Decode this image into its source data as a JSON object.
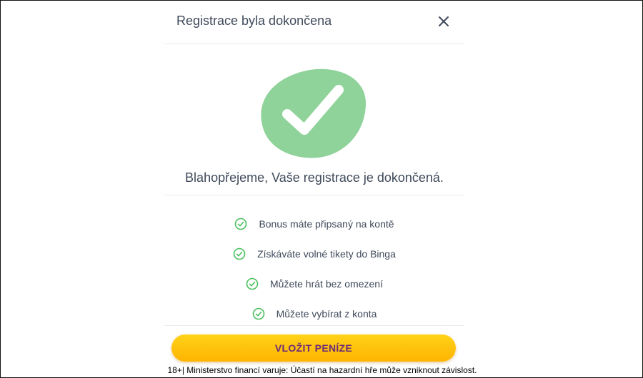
{
  "modal": {
    "title": "Registrace byla dokončena",
    "close_icon": "close-icon",
    "success_icon": "checkmark-icon",
    "headline": "Blahopřejeme, Vaše registrace je dokončená.",
    "benefits": [
      {
        "label": "Bonus máte připsaný na kontě",
        "icon": "check-circle-icon"
      },
      {
        "label": "Získáváte volné tikety do Binga",
        "icon": "check-circle-icon"
      },
      {
        "label": "Můžete hrát bez omezení",
        "icon": "check-circle-icon"
      },
      {
        "label": "Můžete vybírat z konta",
        "icon": "check-circle-icon"
      }
    ],
    "cta_label": "VLOŽIT PENÍZE"
  },
  "footer": {
    "disclaimer": "18+| Ministerstvo financí varuje: Účastí na hazardní hře může vzniknout závislost."
  },
  "colors": {
    "success_green": "#8fd39a",
    "check_green": "#4bbf5e",
    "text": "#3f4a5a",
    "cta_yellow": "#ffc20e",
    "cta_text": "#6a2a78"
  }
}
